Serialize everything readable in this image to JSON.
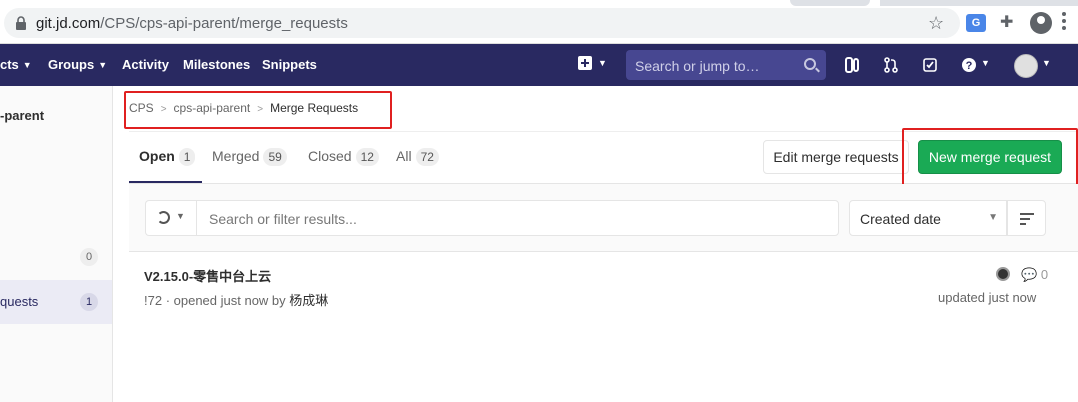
{
  "browser": {
    "url_host": "git.jd.com",
    "url_path": "/CPS/cps-api-parent/merge_requests",
    "translate_icon_text": "G"
  },
  "navbar": {
    "projects_label": "cts",
    "groups_label": "Groups",
    "activity_label": "Activity",
    "milestones_label": "Milestones",
    "snippets_label": "Snippets",
    "search_placeholder": "Search or jump to…",
    "bg_color": "#292961"
  },
  "sidebar": {
    "project_name": "-parent",
    "issues_count": "0",
    "active_item_label": "quests",
    "active_item_count": "1"
  },
  "breadcrumb": {
    "items": [
      "CPS",
      "cps-api-parent",
      "Merge Requests"
    ]
  },
  "tabs": [
    {
      "label": "Open",
      "count": "1"
    },
    {
      "label": "Merged",
      "count": "59"
    },
    {
      "label": "Closed",
      "count": "12"
    },
    {
      "label": "All",
      "count": "72"
    }
  ],
  "actions": {
    "edit_label": "Edit merge requests",
    "new_label": "New merge request",
    "accent_color": "#1aaa55"
  },
  "filter": {
    "search_placeholder": "Search or filter results...",
    "sort_label": "Created date"
  },
  "merge_requests": [
    {
      "title": "V2.15.0-零售中台上云",
      "ref": "!72",
      "opened_text": " · opened just now by ",
      "author": "杨成琳",
      "comments": "0",
      "updated": "updated just now"
    }
  ]
}
